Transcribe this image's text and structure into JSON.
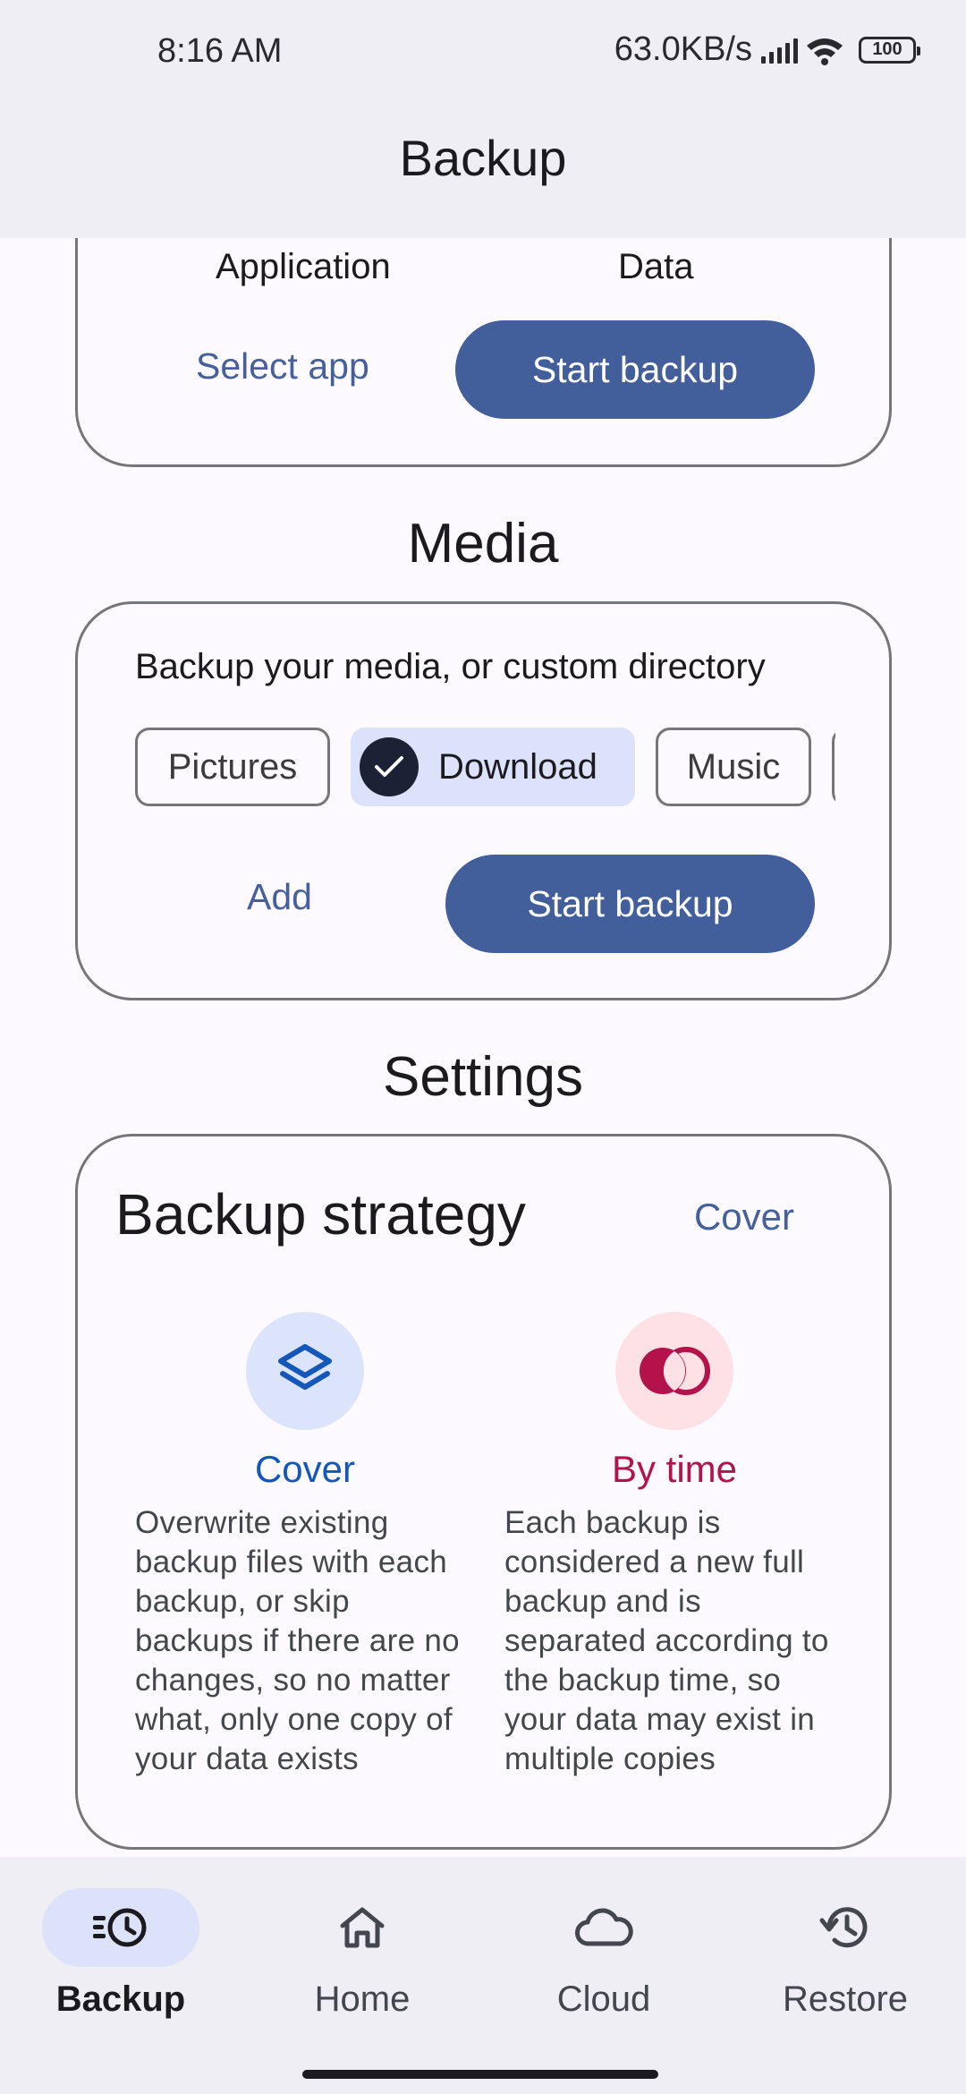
{
  "status_bar": {
    "time": "8:16 AM",
    "net_speed": "63.0KB/s",
    "battery": "100",
    "signal_icon": "signal-icon",
    "wifi_icon": "wifi-icon"
  },
  "app_bar": {
    "title": "Backup"
  },
  "application_section": {
    "col_application": "Application",
    "col_data": "Data",
    "select_app_label": "Select app",
    "start_backup_label": "Start backup"
  },
  "media_section": {
    "title": "Media",
    "description": "Backup your media, or custom directory",
    "chips": [
      {
        "label": "Pictures",
        "selected": false
      },
      {
        "label": "Download",
        "selected": true
      },
      {
        "label": "Music",
        "selected": false
      }
    ],
    "add_label": "Add",
    "start_backup_label": "Start backup"
  },
  "settings_section": {
    "title": "Settings",
    "strategy_title": "Backup strategy",
    "strategy_value": "Cover",
    "options": [
      {
        "label": "Cover",
        "icon": "layers-icon",
        "color": "#1457b8",
        "icon_bg": "#dbe4fb",
        "description": "Overwrite existing backup files with each backup, or skip backups if there are no changes, so no matter what, only one copy of your data exists"
      },
      {
        "label": "By time",
        "icon": "overlapping-circles-icon",
        "color": "#b3124b",
        "icon_bg": "#fde1e4",
        "description": "Each backup is considered a new full backup and is separated according to the backup time, so your data may exist in multiple copies"
      }
    ]
  },
  "bottom_nav": {
    "items": [
      {
        "label": "Backup",
        "icon": "backup-history-icon",
        "active": true
      },
      {
        "label": "Home",
        "icon": "home-icon",
        "active": false
      },
      {
        "label": "Cloud",
        "icon": "cloud-icon",
        "active": false
      },
      {
        "label": "Restore",
        "icon": "restore-icon",
        "active": false
      }
    ]
  },
  "colors": {
    "accent": "#435f9b",
    "text_link": "#45609b",
    "chip_selected_bg": "#dbe2f9",
    "background": "#fcfaff",
    "bar_background": "#eeeef4"
  }
}
